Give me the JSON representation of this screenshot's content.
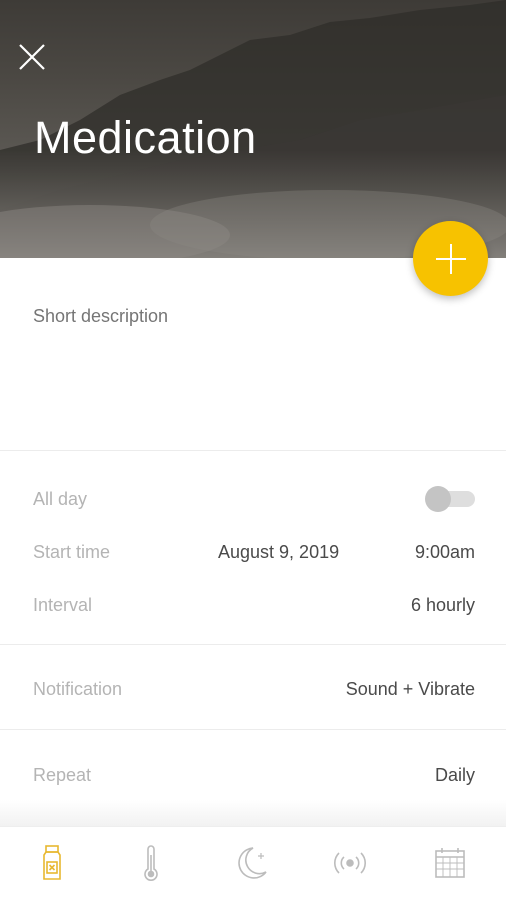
{
  "header": {
    "title": "Medication",
    "close_icon": "close-icon",
    "add_button_icon": "plus-icon",
    "accent_color": "#f7c200"
  },
  "form": {
    "description_placeholder": "Short description",
    "all_day": {
      "label": "All day",
      "enabled": false
    },
    "start_time": {
      "label": "Start time",
      "date": "August 9, 2019",
      "time": "9:00am"
    },
    "interval": {
      "label": "Interval",
      "value": "6 hourly"
    },
    "notification": {
      "label": "Notification",
      "value": "Sound + Vibrate"
    },
    "repeat": {
      "label": "Repeat",
      "value": "Daily"
    }
  },
  "bottom_nav": {
    "items": [
      {
        "icon": "medicine-bottle-icon",
        "active": true,
        "color": "#e8b830"
      },
      {
        "icon": "thermometer-icon",
        "active": false
      },
      {
        "icon": "moon-icon",
        "active": false
      },
      {
        "icon": "broadcast-icon",
        "active": false
      },
      {
        "icon": "calendar-icon",
        "active": false
      }
    ]
  }
}
